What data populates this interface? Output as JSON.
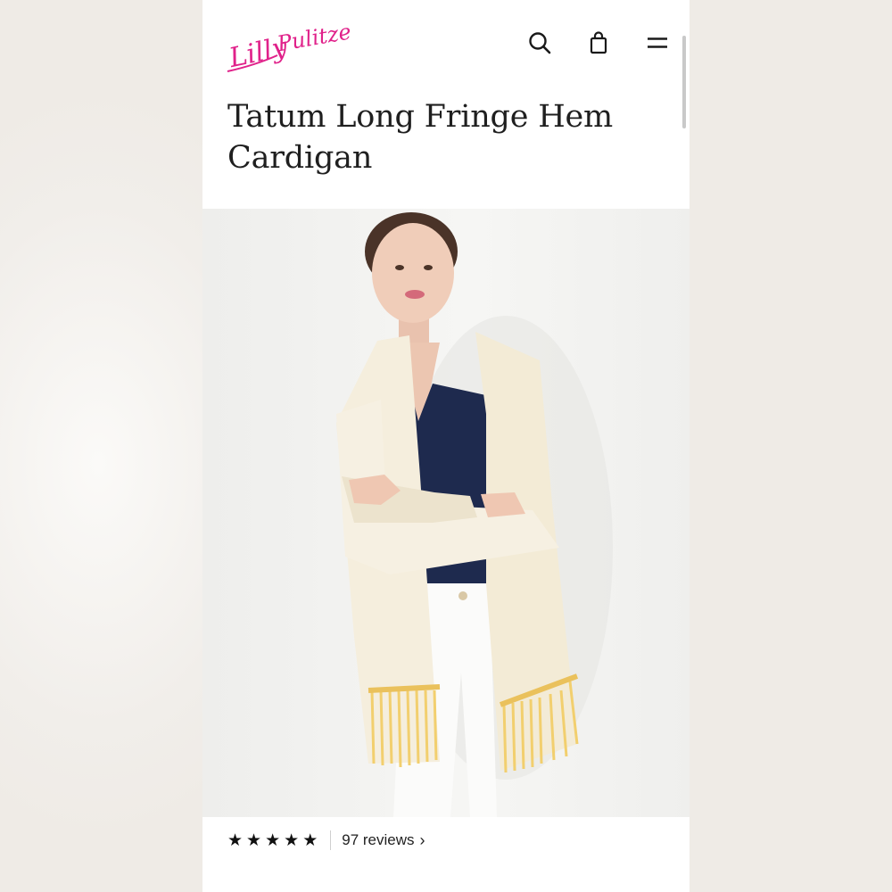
{
  "brand": {
    "name": "Lilly Pulitzer",
    "color": "#e0218a"
  },
  "header": {
    "icons": [
      "search-icon",
      "shopping-bag-icon",
      "menu-icon"
    ]
  },
  "product": {
    "title": "Tatum Long Fringe Hem Cardigan",
    "image_alt": "Model wearing ivory cardigan with yellow fringe hem, navy top and white jeans"
  },
  "rating": {
    "stars": 5,
    "star_glyph": "★",
    "reviews_text": "97 reviews",
    "chevron": "›"
  }
}
